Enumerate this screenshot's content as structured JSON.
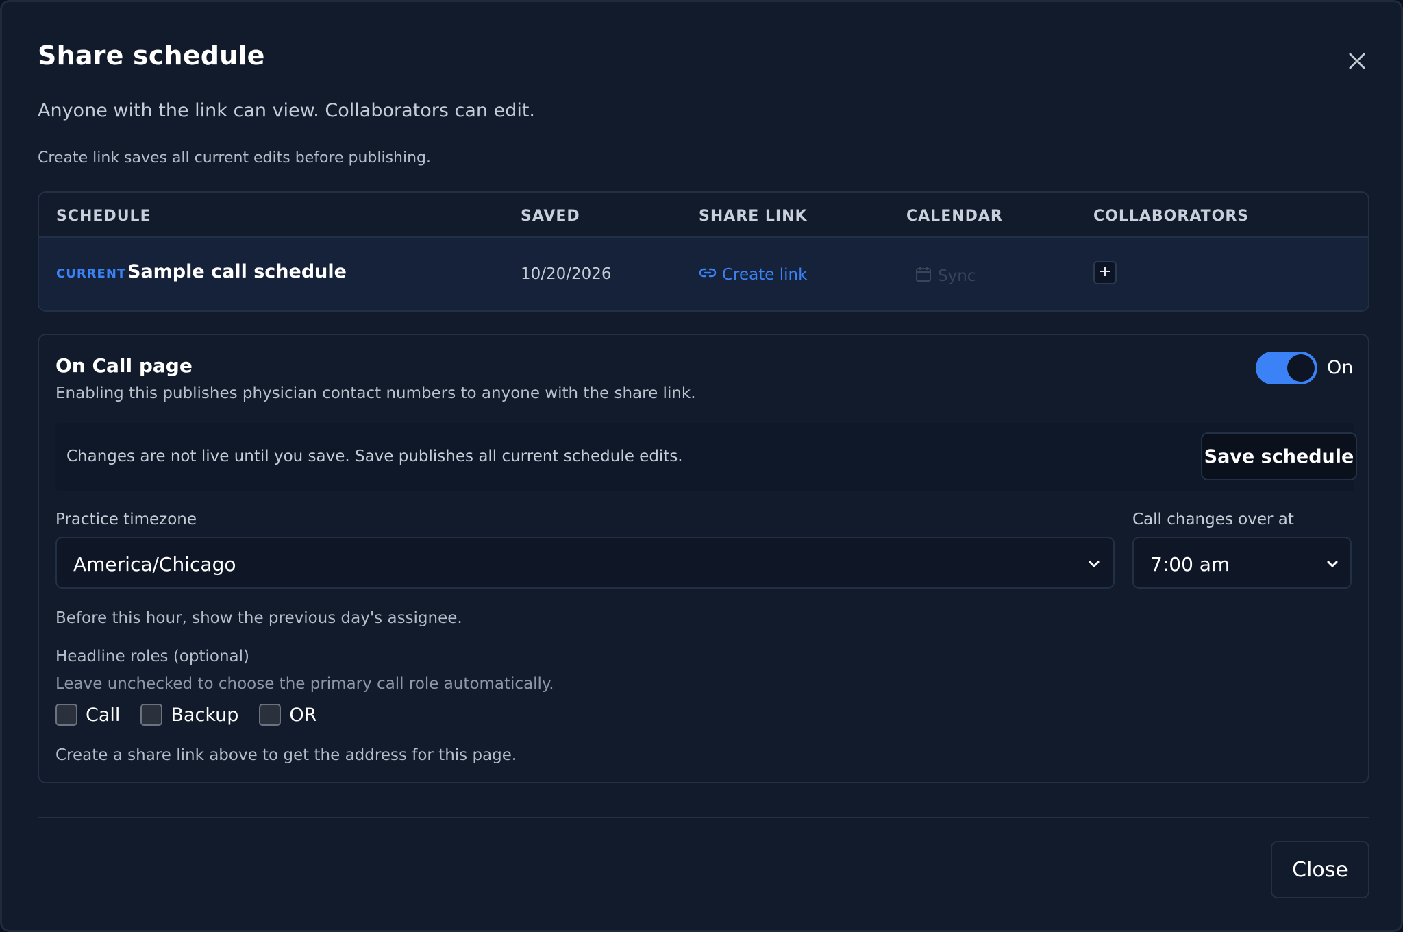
{
  "dialog": {
    "title": "Share schedule",
    "subtitle": "Anyone with the link can view. Collaborators can edit.",
    "note": "Create link saves all current edits before publishing.",
    "close_button_label": "Close"
  },
  "table": {
    "headers": [
      "SCHEDULE",
      "SAVED",
      "SHARE LINK",
      "CALENDAR",
      "COLLABORATORS"
    ],
    "rows": [
      {
        "tag": "CURRENT",
        "name": "Sample call schedule",
        "saved": "10/20/2026",
        "share_link_label": "Create link",
        "calendar_label": "Sync"
      }
    ]
  },
  "oncall": {
    "title": "On Call page",
    "description": "Enabling this publishes physician contact numbers to anyone with the share link.",
    "toggle_label": "On",
    "toggle_on": true,
    "banner_text": "Changes are not live until you save. Save publishes all current schedule edits.",
    "save_button_label": "Save schedule",
    "timezone_label": "Practice timezone",
    "timezone_value": "America/Chicago",
    "changeover_label": "Call changes over at",
    "changeover_value": "7:00 am",
    "changeover_hint": "Before this hour, show the previous day's assignee.",
    "roles_label": "Headline roles (optional)",
    "roles_hint": "Leave unchecked to choose the primary call role automatically.",
    "roles": [
      "Call",
      "Backup",
      "OR"
    ],
    "footer_hint": "Create a share link above to get the address for this page."
  },
  "colors": {
    "background": "#111b2b",
    "accent": "#3b82f6",
    "border": "#223046"
  },
  "icons": [
    "close-icon",
    "link-icon",
    "calendar-icon",
    "plus-icon",
    "chevron-down-icon"
  ]
}
